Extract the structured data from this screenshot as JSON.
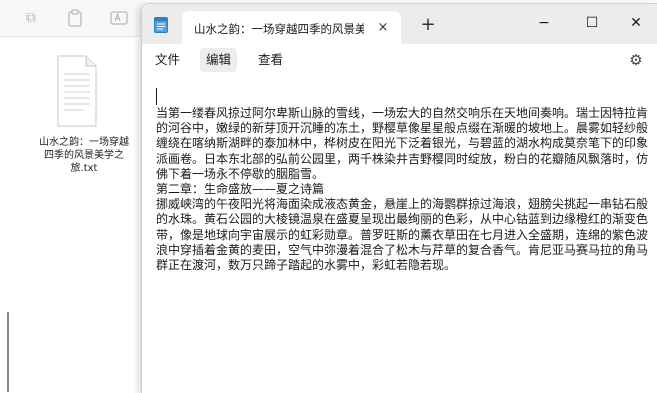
{
  "explorer": {
    "file_label": "山水之韵：一场穿越四季的风景美学之旅.txt"
  },
  "window": {
    "tab_title": "山水之韵：一场穿越四季的风景美学",
    "tab_close": "×",
    "new_tab": "+",
    "minimize": "−",
    "maximize": "☐",
    "close": "✕"
  },
  "menu": {
    "file": "文件",
    "edit": "编辑",
    "view": "查看"
  },
  "document": {
    "text": "当第一缕春风掠过阿尔卑斯山脉的雪线，一场宏大的自然交响乐在天地间奏响。瑞士因特拉肯的河谷中，嫩绿的新芽顶开沉睡的冻土，野樱草像星星般点缀在渐暖的坡地上。晨雾如轻纱般缠绕在喀纳斯湖畔的泰加林中，桦树皮在阳光下泛着银光，与碧蓝的湖水构成莫奈笔下的印象派画卷。日本东北部的弘前公园里，两千株染井吉野樱同时绽放，粉白的花瓣随风飘落时，仿佛下着一场永不停歇的胭脂雪。\n第二章：生命盛放——夏之诗篇\n挪威峡湾的午夜阳光将海面染成液态黄金，悬崖上的海鹦群掠过海浪，翅膀尖挑起一串钻石般的水珠。黄石公园的大棱镜温泉在盛夏呈现出最绚丽的色彩，从中心钴蓝到边缘橙红的渐变色带，像是地球向宇宙展示的虹彩勋章。普罗旺斯的薰衣草田在七月进入全盛期，连绵的紫色波浪中穿插着金黄的麦田，空气中弥漫着混合了松木与芹草的复合香气。肯尼亚马赛马拉的角马群正在渡河，数万只蹄子踏起的水雾中，彩虹若隐若现。"
  }
}
